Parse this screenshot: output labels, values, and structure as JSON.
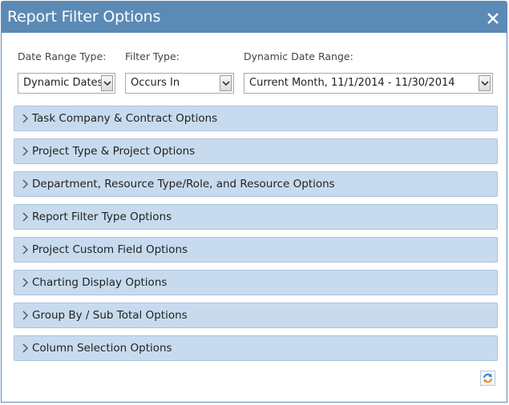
{
  "window": {
    "title": "Report Filter Options"
  },
  "filters": {
    "date_range_type": {
      "label": "Date Range Type:",
      "value": "Dynamic Dates"
    },
    "filter_type": {
      "label": "Filter Type:",
      "value": "Occurs In"
    },
    "dynamic_date_range": {
      "label": "Dynamic Date Range:",
      "value": "Current Month, 11/1/2014 - 11/30/2014"
    }
  },
  "sections": [
    {
      "label": "Task Company & Contract Options"
    },
    {
      "label": "Project Type & Project Options"
    },
    {
      "label": "Department, Resource Type/Role, and Resource Options"
    },
    {
      "label": "Report Filter Type Options"
    },
    {
      "label": "Project Custom Field Options"
    },
    {
      "label": "Charting Display Options"
    },
    {
      "label": "Group By / Sub Total Options"
    },
    {
      "label": "Column Selection Options"
    }
  ],
  "colors": {
    "titlebar": "#5b8ab5",
    "panel_bg": "#c8dbee",
    "panel_border": "#a9c2db"
  },
  "icons": {
    "close": "close-icon",
    "expand": "chevron-right-icon",
    "dropdown": "chevron-down-icon",
    "refresh": "refresh-icon"
  }
}
